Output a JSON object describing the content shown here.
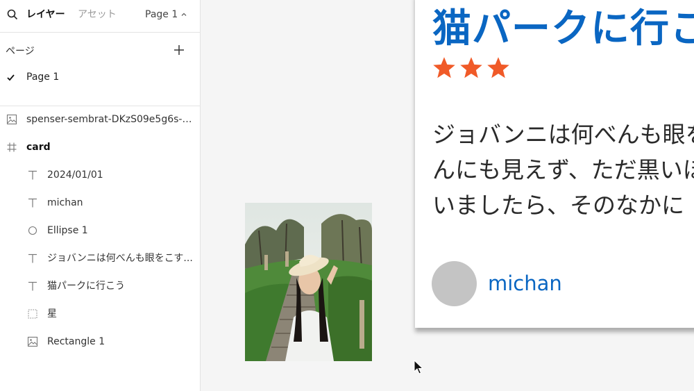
{
  "topbar": {
    "layers_tab": "レイヤー",
    "assets_tab": "アセット",
    "current_page": "Page 1"
  },
  "pages": {
    "label": "ページ",
    "items": [
      {
        "name": "Page 1",
        "selected": true
      }
    ]
  },
  "layers": [
    {
      "name": "spenser-sembrat-DKzS09e5g6s-u...",
      "icon": "image-icon",
      "level": 0
    },
    {
      "name": "card",
      "icon": "frame-icon",
      "level": 0
    },
    {
      "name": "2024/01/01",
      "icon": "text-icon",
      "level": 1
    },
    {
      "name": "michan",
      "icon": "text-icon",
      "level": 1
    },
    {
      "name": "Ellipse 1",
      "icon": "ellipse-icon",
      "level": 1
    },
    {
      "name": "ジョバンニは何べんも眼をこす...",
      "icon": "text-icon",
      "level": 1
    },
    {
      "name": "猫パークに行こう",
      "icon": "text-icon",
      "level": 1
    },
    {
      "name": "星",
      "icon": "group-icon",
      "level": 1
    },
    {
      "name": "Rectangle 1",
      "icon": "image-icon",
      "level": 1
    }
  ],
  "card": {
    "title": "猫パークに行こう",
    "rating": 3,
    "body": "ジョバンニは何べんも眼をこすってみましたけれども\nんにも見えず、ただ黒いほらあなが、どほんとあいて\nいましたら、そのなかに",
    "author": "michan"
  },
  "colors": {
    "title": "#0a66c2",
    "star": "#f05a28",
    "avatar": "#c4c4c4",
    "author": "#0a66c2"
  }
}
